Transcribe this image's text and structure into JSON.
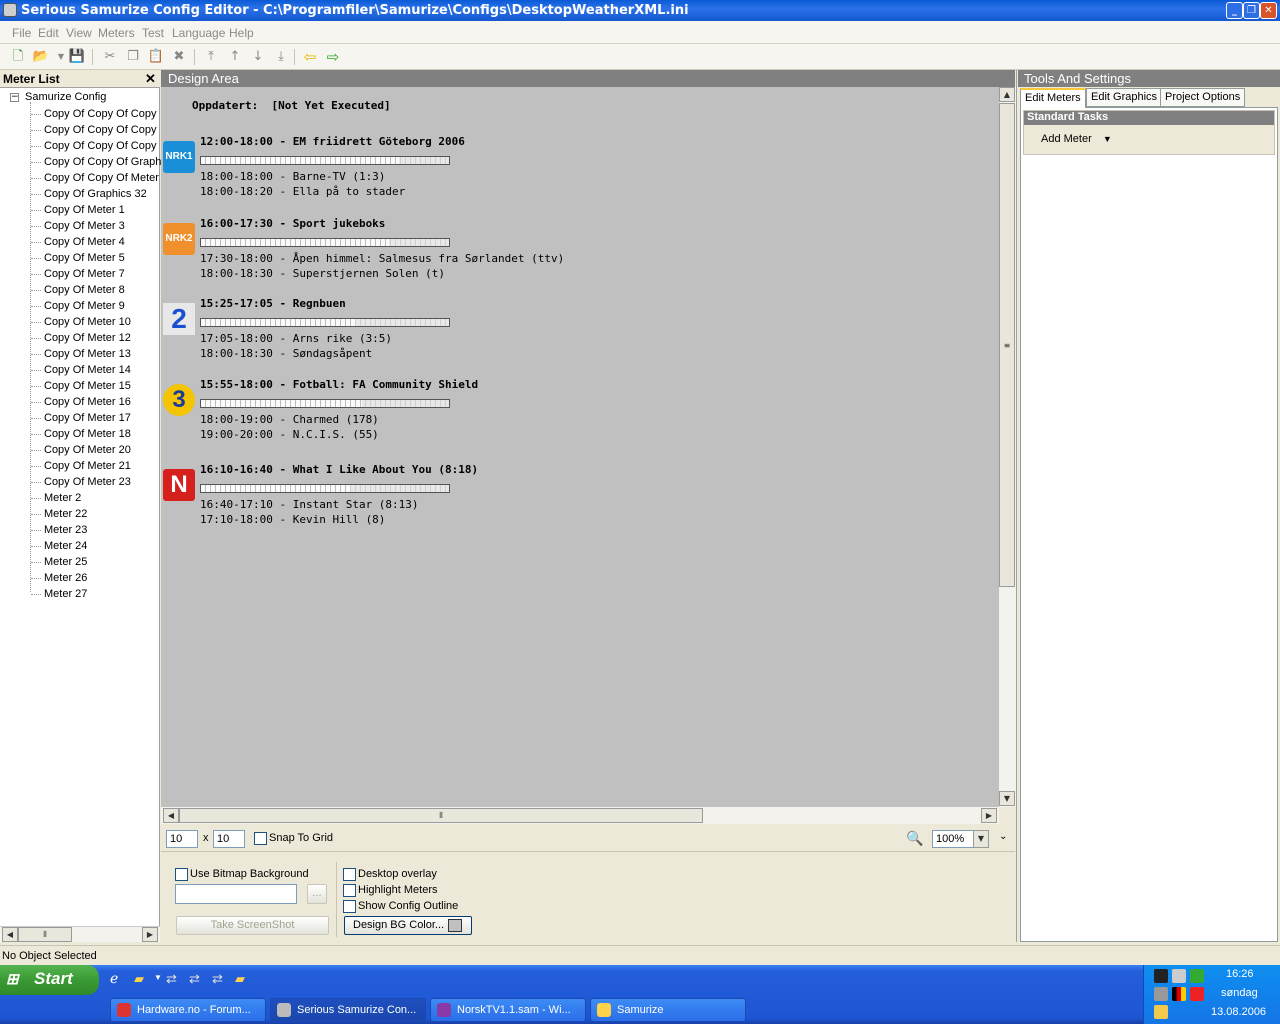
{
  "window": {
    "title": "Serious Samurize Config Editor - C:\\Programfiler\\Samurize\\Configs\\DesktopWeatherXML.ini",
    "buttons": {
      "minimize": "_",
      "maximize": "❐",
      "close": "✕"
    }
  },
  "menu": [
    "File",
    "Edit",
    "View",
    "Meters",
    "Test",
    "Language",
    "Help"
  ],
  "toolbar": {
    "icons": [
      "new-icon",
      "open-icon",
      "save-icon",
      "cut-icon",
      "copy-icon",
      "paste-icon",
      "delete-icon",
      "move-top-icon",
      "move-up-icon",
      "move-down-icon",
      "move-bottom-icon",
      "arrow-left-icon",
      "arrow-right-icon"
    ]
  },
  "meter_list": {
    "title": "Meter List",
    "close": "✕",
    "root": "Samurize Config",
    "items": [
      "Copy Of Copy Of Copy",
      "Copy Of Copy Of Copy",
      "Copy Of Copy Of Copy",
      "Copy Of Copy Of Graph",
      "Copy Of Copy Of Meter",
      "Copy Of Graphics 32",
      "Copy Of Meter 1",
      "Copy Of Meter 3",
      "Copy Of Meter 4",
      "Copy Of Meter 5",
      "Copy Of Meter 7",
      "Copy Of Meter 8",
      "Copy Of Meter 9",
      "Copy Of Meter 10",
      "Copy Of Meter 12",
      "Copy Of Meter 13",
      "Copy Of Meter 14",
      "Copy Of Meter 15",
      "Copy Of Meter 16",
      "Copy Of Meter 17",
      "Copy Of Meter 18",
      "Copy Of Meter 20",
      "Copy Of Meter 21",
      "Copy Of Meter 23",
      "Meter 2",
      "Meter 22",
      "Meter 23",
      "Meter 24",
      "Meter 25",
      "Meter 26",
      "Meter 27"
    ]
  },
  "design": {
    "title": "Design Area",
    "updated": "Oppdatert:  [Not Yet Executed]",
    "channels": [
      {
        "logo": "NRK1",
        "logo_color": "#1a8fd8",
        "now": "12:00-18:00 - EM friidrett Göteborg 2006",
        "progress": 0.8,
        "next1": "18:00-18:00 - Barne-TV (1:3)",
        "next2": "18:00-18:20 - Ella på to stader"
      },
      {
        "logo": "NRK2",
        "logo_color": "#f0902c",
        "now": "16:00-17:30 - Sport jukeboks",
        "progress": 0.76,
        "next1": "17:30-18:00 - Åpen himmel: Salmesus fra Sørlandet (ttv)",
        "next2": "18:00-18:30 - Superstjernen Solen (t)"
      },
      {
        "logo": "2",
        "logo_color": "#e8e8e8",
        "now": "15:25-17:05 - Regnbuen",
        "progress": 0.62,
        "next1": "17:05-18:00 - Arns rike (3:5)",
        "next2": "18:00-18:30 - Søndagsåpent"
      },
      {
        "logo": "3",
        "logo_color": "#f4c400",
        "now": "15:55-18:00 - Fotball: FA Community Shield",
        "progress": 0.65,
        "next1": "18:00-19:00 - Charmed (178)",
        "next2": "19:00-20:00 - N.C.I.S. (55)"
      },
      {
        "logo": "N",
        "logo_color": "#d6201c",
        "now": "16:10-16:40 - What I Like About You (8:18)",
        "progress": 0.6,
        "next1": "16:40-17:10 - Instant Star (8:13)",
        "next2": "17:10-18:00 - Kevin Hill (8)"
      }
    ]
  },
  "grid": {
    "x": "10",
    "sep": "x",
    "y": "10",
    "snap_label": "Snap To Grid",
    "zoom": "100%"
  },
  "options": {
    "use_bitmap": "Use Bitmap Background",
    "browse": "...",
    "screenshot": "Take ScreenShot",
    "desktop_overlay": "Desktop overlay",
    "highlight": "Highlight Meters",
    "outline": "Show Config Outline",
    "bg_color": "Design BG Color..."
  },
  "tools": {
    "title": "Tools And Settings",
    "tabs": [
      "Edit Meters",
      "Edit Graphics",
      "Project Options"
    ],
    "section": "Standard Tasks",
    "add_meter": "Add Meter"
  },
  "status": "No Object Selected",
  "taskbar": {
    "start": "Start",
    "items": [
      "Hardware.no - Forum...",
      "Serious Samurize Con...",
      "NorskTV1.1.sam - Wi...",
      "Samurize"
    ],
    "time": "16:26",
    "day": "søndag",
    "date": "13.08.2006"
  }
}
